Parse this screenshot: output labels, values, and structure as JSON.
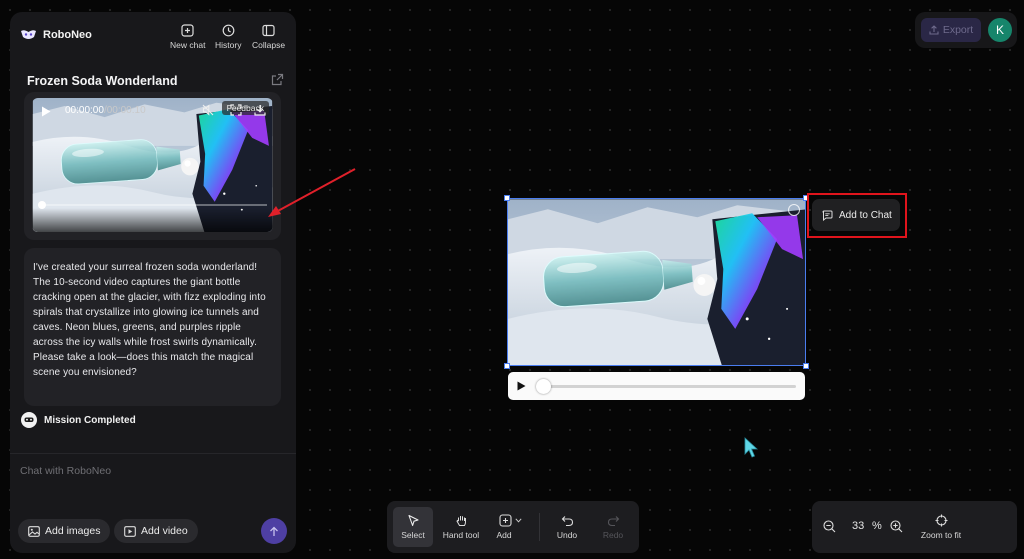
{
  "brand": {
    "name": "RoboNeo"
  },
  "header": {
    "new_chat": "New chat",
    "history": "History",
    "collapse": "Collapse"
  },
  "conversation": {
    "title": "Frozen Soda Wonderland"
  },
  "video_card": {
    "feedback": "Feedback",
    "current_time": "00:00:00",
    "duration": "/00:00:10"
  },
  "message": {
    "text": "I've created your surreal frozen soda wonderland! The 10-second video captures the giant bottle cracking open at the glacier, with fizz exploding into spirals that crystallize into glowing ice tunnels and caves. Neon blues, greens, and purples ripple across the icy walls while frost swirls dynamically. Please take a look—does this match the magical scene you envisioned?"
  },
  "status": {
    "mission": "Mission Completed"
  },
  "composer": {
    "placeholder": "Chat with RoboNeo",
    "add_images": "Add images",
    "add_video": "Add video"
  },
  "topbar": {
    "export": "Export",
    "avatar_initial": "K"
  },
  "canvas": {
    "add_to_chat": "Add to Chat",
    "progress_fraction": 0.0
  },
  "toolbar": {
    "select": "Select",
    "hand_tool": "Hand tool",
    "add": "Add",
    "undo": "Undo",
    "redo": "Redo"
  },
  "zoom": {
    "value": "33",
    "unit": "%",
    "zoom_to_fit": "Zoom to fit"
  },
  "colors": {
    "accent": "#4e3fa3",
    "selection": "#4a7df0",
    "highlight": "#e0141c",
    "annotation_arrow": "#e0202a",
    "avatar": "#16856b"
  }
}
